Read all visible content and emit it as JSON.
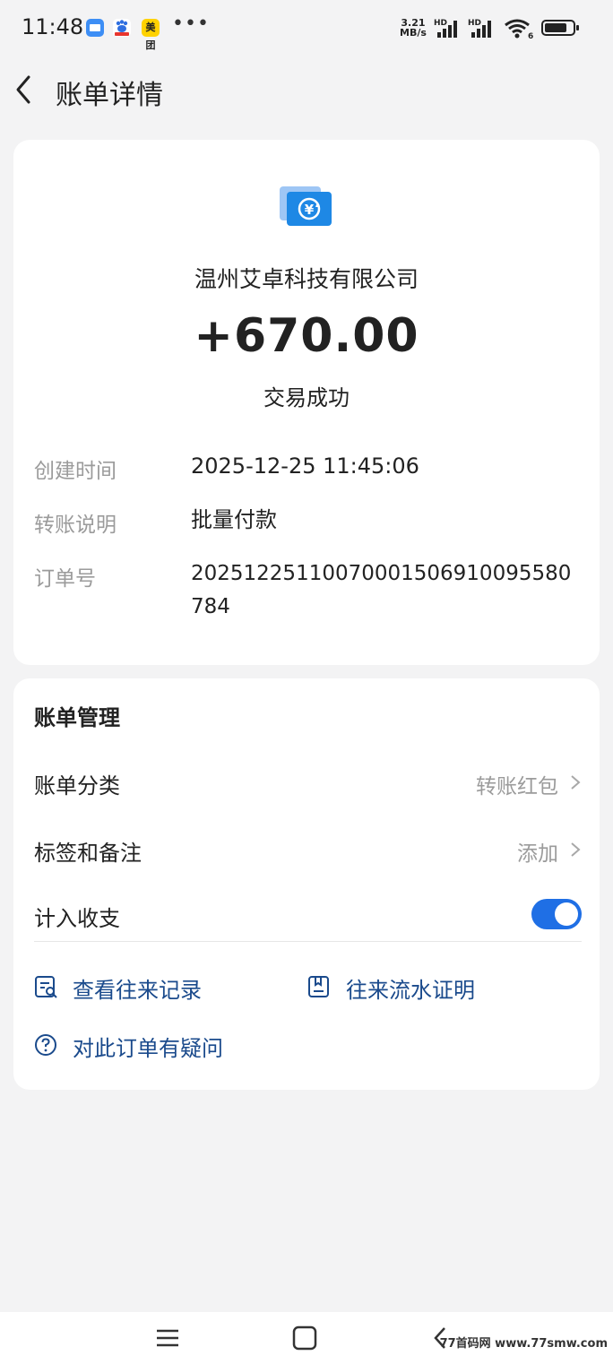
{
  "status_bar": {
    "time": "11:48",
    "notif_app_label": "美团",
    "net_speed_value": "3.21",
    "net_speed_unit": "MB/s",
    "signal_tag": "HD",
    "wifi_badge": "6"
  },
  "header": {
    "title": "账单详情"
  },
  "transaction": {
    "payer": "温州艾卓科技有限公司",
    "amount": "+670.00",
    "status": "交易成功",
    "details": [
      {
        "label": "创建时间",
        "value": "2025-12-25 11:45:06"
      },
      {
        "label": "转账说明",
        "value": "批量付款"
      },
      {
        "label": "订单号",
        "value": "20251225110070001506910095580784"
      }
    ]
  },
  "management": {
    "title": "账单管理",
    "category_label": "账单分类",
    "category_value": "转账红包",
    "tags_label": "标签和备注",
    "tags_value": "添加",
    "count_label": "计入收支",
    "count_enabled": true,
    "links": {
      "records": "查看往来记录",
      "proof": "往来流水证明",
      "question": "对此订单有疑问"
    }
  },
  "watermark": "77首码网 www.77smw.com",
  "colors": {
    "accent": "#1f6fe5",
    "link": "#1a4a8c",
    "muted": "#9b9b9b",
    "background": "#f3f3f4"
  }
}
